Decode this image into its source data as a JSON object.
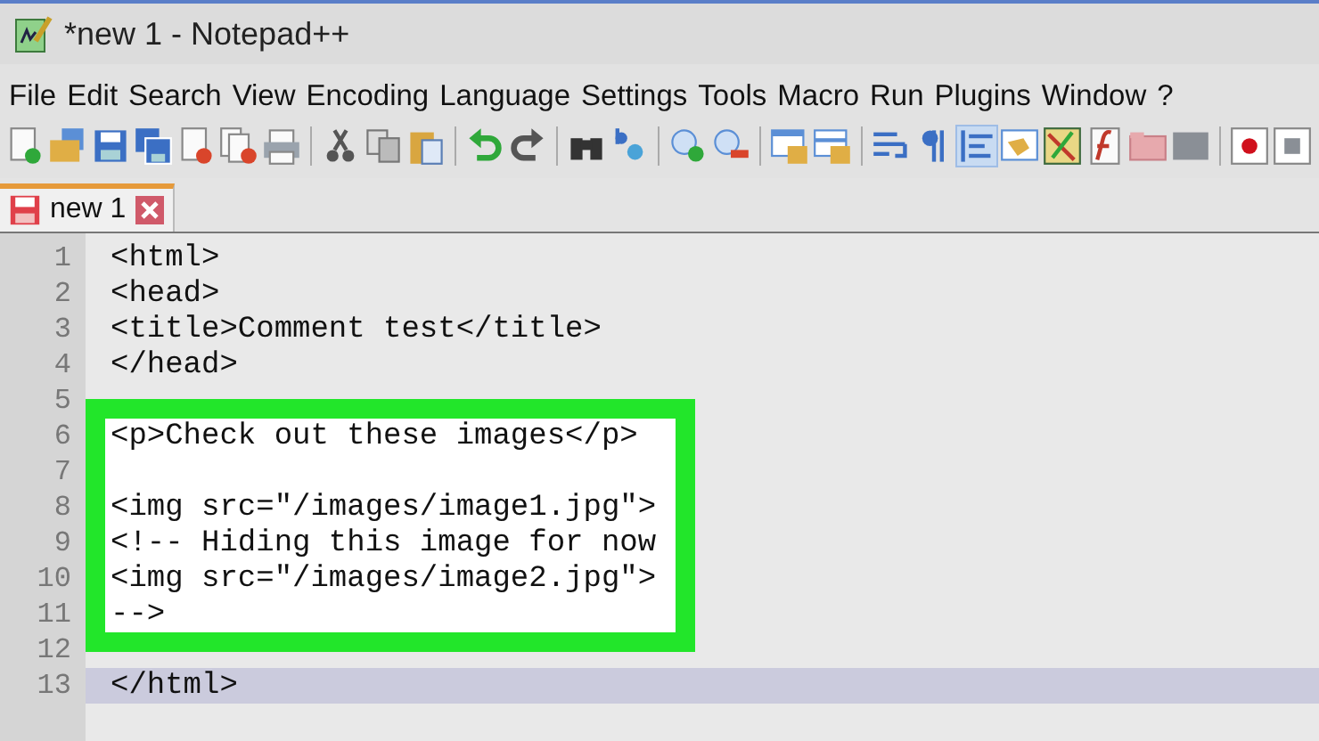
{
  "window": {
    "title": "*new 1 - Notepad++"
  },
  "menu": [
    "File",
    "Edit",
    "Search",
    "View",
    "Encoding",
    "Language",
    "Settings",
    "Tools",
    "Macro",
    "Run",
    "Plugins",
    "Window",
    "?"
  ],
  "tabs": [
    {
      "label": "new 1",
      "selected": true,
      "modified": true
    }
  ],
  "editor": {
    "lines": [
      {
        "number": "1",
        "code": "<html>",
        "current": false,
        "boxed": false
      },
      {
        "number": "2",
        "code": "<head>",
        "current": false,
        "boxed": false
      },
      {
        "number": "3",
        "code": "<title>Comment test</title>",
        "current": false,
        "boxed": false
      },
      {
        "number": "4",
        "code": "</head>",
        "current": false,
        "boxed": false
      },
      {
        "number": "5",
        "current": false,
        "boxed": false
      },
      {
        "number": "6",
        "code": "<p>Check out these images</p>",
        "current": false,
        "boxed": true
      },
      {
        "number": "7",
        "current": false,
        "boxed": true
      },
      {
        "number": "8",
        "code": "<img src=\"/images/image1.jpg\">",
        "current": false,
        "boxed": true
      },
      {
        "number": "9",
        "code": "<!-- Hiding this image for now",
        "current": false,
        "boxed": true
      },
      {
        "number": "10",
        "code": "<img src=\"/images/image2.jpg\">",
        "current": false,
        "boxed": true
      },
      {
        "number": "11",
        "code": "-->",
        "current": false,
        "boxed": true
      },
      {
        "number": "12",
        "current": false,
        "boxed": false
      },
      {
        "number": "13",
        "code": "</html>",
        "current": true,
        "boxed": false
      }
    ]
  }
}
